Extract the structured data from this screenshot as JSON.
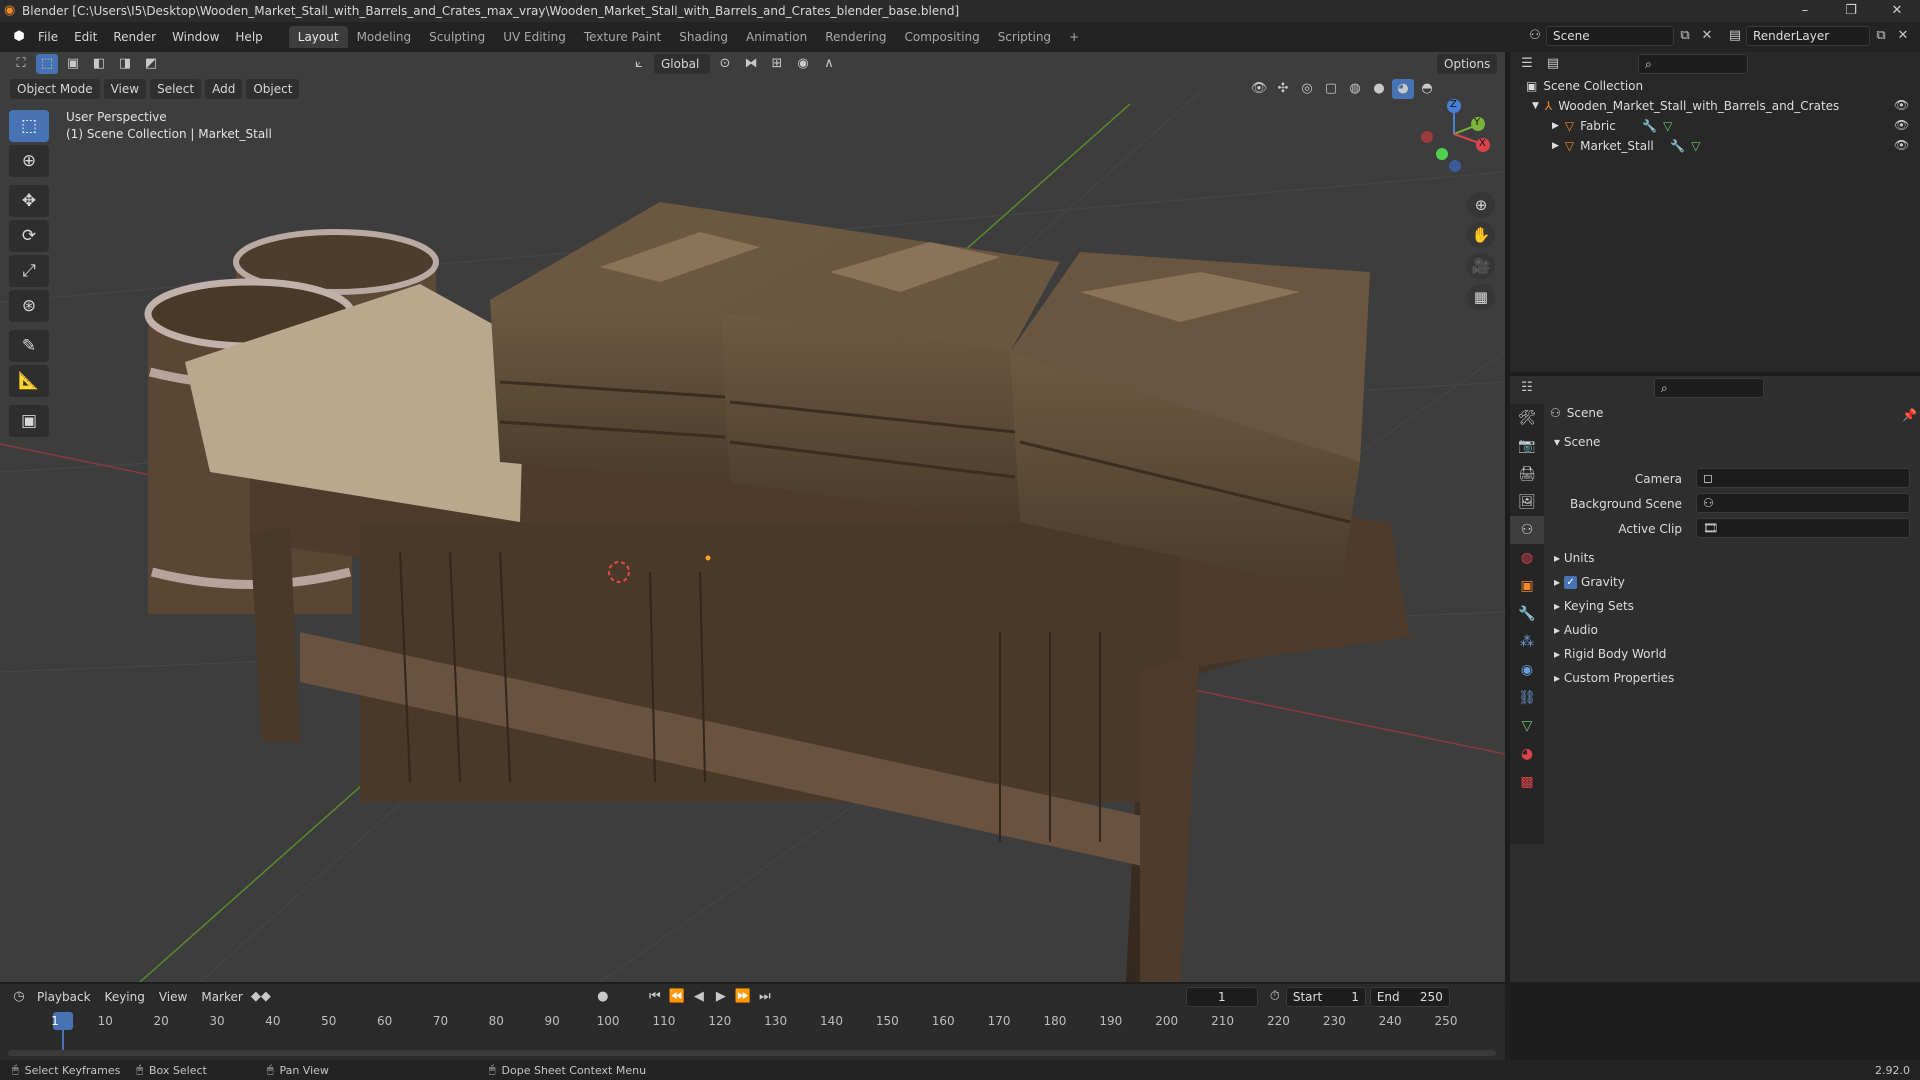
{
  "window": {
    "title": "Blender [C:\\Users\\I5\\Desktop\\Wooden_Market_Stall_with_Barrels_and_Crates_max_vray\\Wooden_Market_Stall_with_Barrels_and_Crates_blender_base.blend]",
    "minimize": "–",
    "maximize": "❐",
    "close": "✕"
  },
  "menu": {
    "items": [
      "File",
      "Edit",
      "Render",
      "Window",
      "Help"
    ],
    "workspaces": [
      "Layout",
      "Modeling",
      "Sculpting",
      "UV Editing",
      "Texture Paint",
      "Shading",
      "Animation",
      "Rendering",
      "Compositing",
      "Scripting"
    ],
    "add_tab": "+",
    "scene": "Scene",
    "render_layer": "RenderLayer"
  },
  "viewport": {
    "mode": "Object Mode",
    "menus": [
      "View",
      "Select",
      "Add",
      "Object"
    ],
    "transform_orientation": "Global",
    "options": "Options",
    "perspective": "User Perspective",
    "collection_info": "(1) Scene Collection | Market_Stall",
    "gizmo": {
      "x": "X",
      "y": "Y",
      "z": "Z"
    }
  },
  "tools": [
    "select-box-tool",
    "cursor-tool",
    "move-tool",
    "rotate-tool",
    "scale-tool",
    "transform-tool",
    "annotate-tool",
    "measure-tool",
    "add-cube-tool"
  ],
  "outliner": {
    "root": "Scene Collection",
    "collection": "Wooden_Market_Stall_with_Barrels_and_Crates",
    "objects": [
      "Fabric",
      "Market_Stall"
    ]
  },
  "properties": {
    "header": "Scene",
    "panel": "Scene",
    "camera_label": "Camera",
    "background_label": "Background Scene",
    "clip_label": "Active Clip",
    "sections": [
      "Units",
      "Gravity",
      "Keying Sets",
      "Audio",
      "Rigid Body World",
      "Custom Properties"
    ],
    "gravity_checked": true
  },
  "timeline": {
    "menus": [
      "Playback",
      "Keying",
      "View",
      "Marker"
    ],
    "current_frame": "1",
    "start_label": "Start",
    "start": "1",
    "end_label": "End",
    "end": "250",
    "ticks": [
      "1",
      "10",
      "20",
      "30",
      "40",
      "50",
      "60",
      "70",
      "80",
      "90",
      "100",
      "110",
      "120",
      "130",
      "140",
      "150",
      "160",
      "170",
      "180",
      "190",
      "200",
      "210",
      "220",
      "230",
      "240",
      "250"
    ]
  },
  "statusbar": {
    "select": "Select Keyframes",
    "box": "Box Select",
    "pan": "Pan View",
    "context": "Dope Sheet Context Menu",
    "version": "2.92.0"
  },
  "colors": {
    "accent": "#4772b3",
    "header": "#2b2b2b",
    "viewport": "#3d3d3d"
  }
}
